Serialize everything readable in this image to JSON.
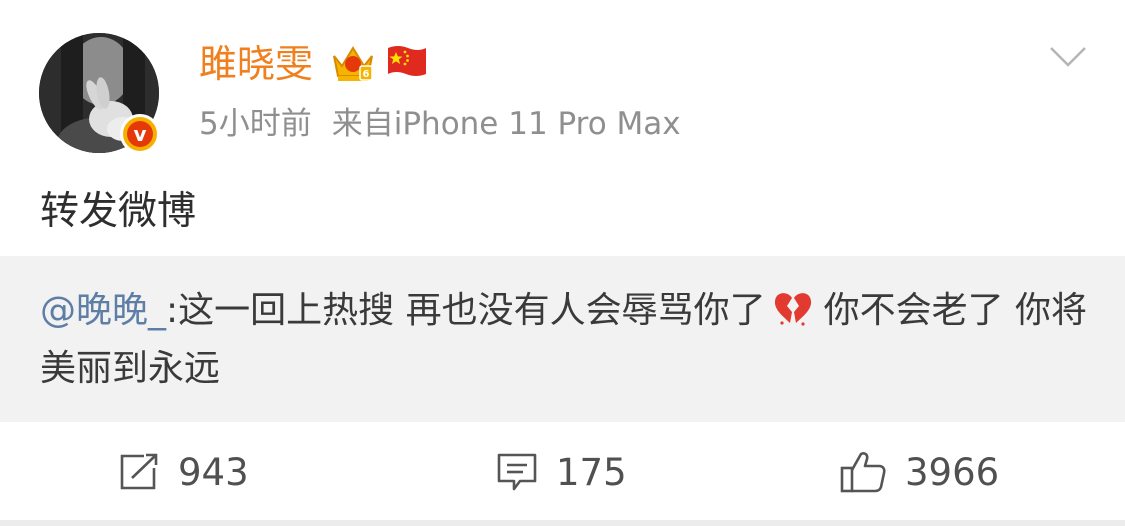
{
  "post": {
    "author": {
      "name": "雎晓雯",
      "badges": [
        "crown-icon",
        "china-flag-icon"
      ]
    },
    "time": "5小时前",
    "source": "来自iPhone 11 Pro Max",
    "text": "转发微博",
    "quoted": {
      "mention": "@晚晚_",
      "text_part1": ":这一回上热搜 再也没有人会辱骂你了",
      "emoji": "broken-heart-icon",
      "text_part2": "你不会老了 你将美丽到永远"
    },
    "actions": {
      "repost_count": "943",
      "comment_count": "175",
      "like_count": "3966"
    }
  },
  "colors": {
    "username": "#f0801e",
    "meta": "#8f8f8f",
    "mention": "#5e7ea6",
    "quote_bg": "#f2f2f2",
    "verified": "#f6b100"
  }
}
